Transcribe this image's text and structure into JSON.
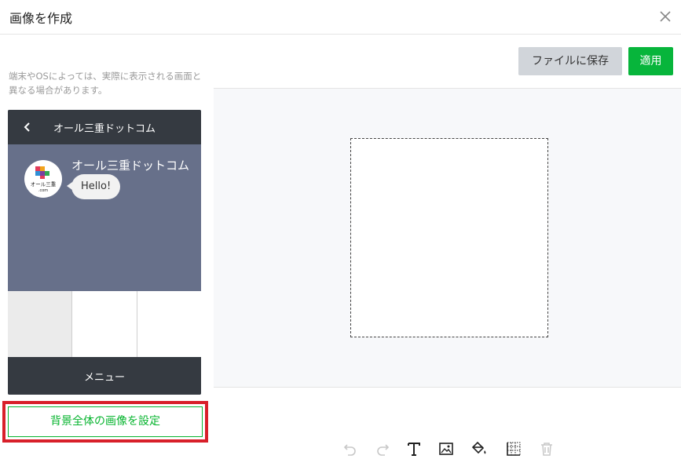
{
  "dialog": {
    "title": "画像を作成"
  },
  "left_panel": {
    "note": "端末やOSによっては、実際に表示される画面と異なる場合があります。",
    "preview": {
      "header_title": "オール三重ドットコム",
      "chat": {
        "sender_name": "オール三重ドットコム",
        "message": "Hello!",
        "avatar_text_top": "オール三重",
        "avatar_text_bottom": ".com"
      },
      "menu_cells": 3,
      "footer_label": "メニュー"
    },
    "background_button_label": "背景全体の画像を設定"
  },
  "right_panel": {
    "save_label": "ファイルに保存",
    "apply_label": "適用",
    "tools": [
      "undo-icon",
      "redo-icon",
      "text-icon",
      "image-icon",
      "fill-icon",
      "grid-icon",
      "trash-icon"
    ]
  },
  "colors": {
    "accent_green": "#06b42e",
    "highlight_red": "#d8202a",
    "phone_header": "#353a41",
    "phone_body": "#67708a"
  }
}
